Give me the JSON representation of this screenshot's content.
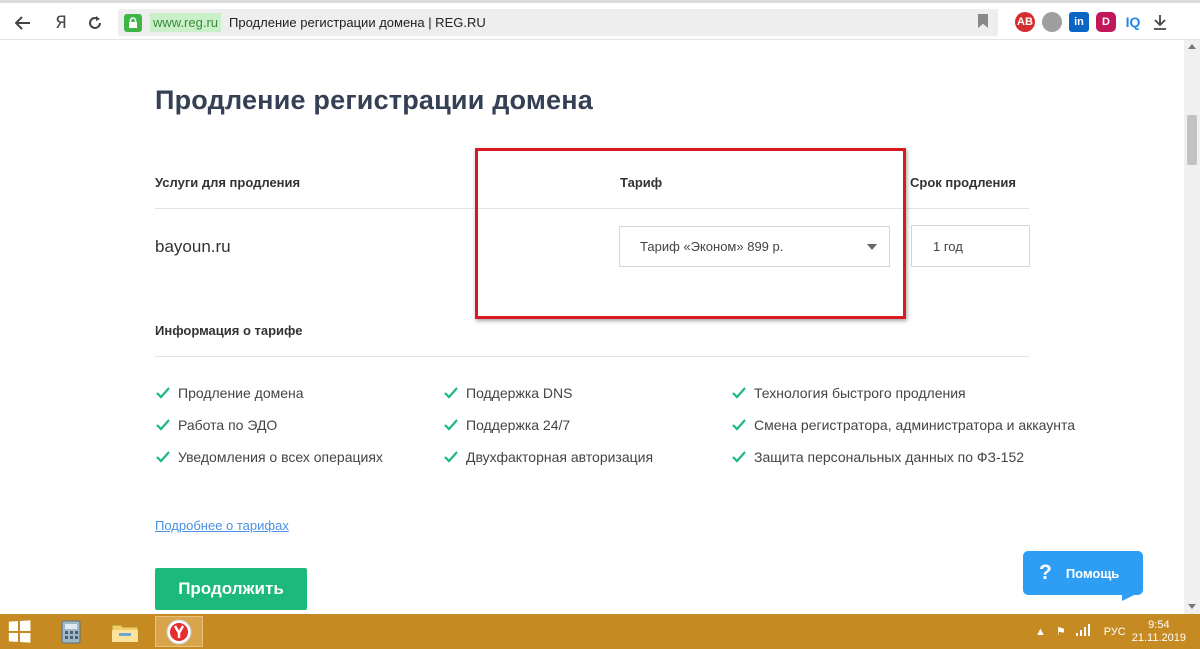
{
  "browser": {
    "url_host": "www.reg.ru",
    "tab_title": "Продление регистрации домена | REG.RU",
    "yandex_label": "Я",
    "extensions": [
      {
        "name": "abp-icon",
        "label": "AB",
        "color": "#d32f2f"
      },
      {
        "name": "globe-icon",
        "label": "",
        "color": "#9e9e9e"
      },
      {
        "name": "linkedin-icon",
        "label": "in",
        "color": "#0a66c2"
      },
      {
        "name": "d-extension-icon",
        "label": "D",
        "color": "#c2185b"
      },
      {
        "name": "iq-icon",
        "label": "IQ",
        "color": "#1e88e5"
      }
    ]
  },
  "page": {
    "title": "Продление регистрации домена",
    "columns": {
      "services": "Услуги для продления",
      "tariff": "Тариф",
      "term": "Срок продления"
    },
    "domain": "bayoun.ru",
    "tariff_selected": "Тариф «Эконом» 899 р.",
    "term_value": "1 год",
    "info_heading": "Информация о тарифе",
    "features": [
      [
        "Продление домена",
        "Работа по ЭДО",
        "Уведомления о всех операциях"
      ],
      [
        "Поддержка DNS",
        "Поддержка 24/7",
        "Двухфакторная авторизация"
      ],
      [
        "Технология быстрого продления",
        "Смена регистратора, администратора и аккаунта",
        "Защита персональных данных по ФЗ-152"
      ]
    ],
    "more_link": "Подробнее о тарифах",
    "continue_button": "Продолжить",
    "help_button": "Помощь",
    "help_q": "?",
    "accent_color": "#1bb97c",
    "highlight_color": "#d61c22"
  },
  "taskbar": {
    "language": "РУС",
    "time": "9:54",
    "date": "21.11.2019"
  }
}
